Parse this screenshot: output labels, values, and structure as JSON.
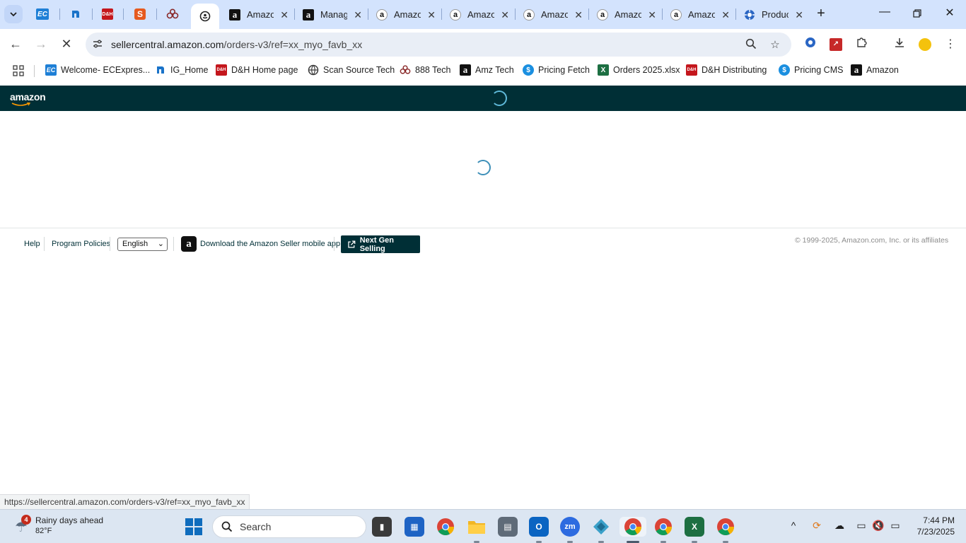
{
  "browser": {
    "tabs": [
      {
        "title": "Amazon",
        "favicon": "amazon-icon",
        "active": false
      },
      {
        "title": "Manage",
        "favicon": "amazon-icon",
        "active": false
      },
      {
        "title": "Amazon",
        "favicon": "amazon-smile-icon",
        "active": false
      },
      {
        "title": "Amazon",
        "favicon": "amazon-smile-icon",
        "active": false
      },
      {
        "title": "Amazon",
        "favicon": "amazon-smile-icon",
        "active": false
      },
      {
        "title": "Amazon",
        "favicon": "amazon-smile-icon",
        "active": false
      },
      {
        "title": "Amazon",
        "favicon": "amazon-smile-icon",
        "active": false
      },
      {
        "title": "Product",
        "favicon": "globe-icon",
        "active": false
      }
    ],
    "url_host": "sellercentral.amazon.com",
    "url_path": "/orders-v3/ref=xx_myo_favb_xx",
    "bookmarks": [
      {
        "label": "Welcome- ECExpres...",
        "favicon": "ec-icon"
      },
      {
        "label": "IG_Home",
        "favicon": "ig-icon"
      },
      {
        "label": "D&H Home page",
        "favicon": "dh-icon"
      },
      {
        "label": "Scan Source Tech",
        "favicon": "scansource-icon"
      },
      {
        "label": "888 Tech",
        "favicon": "888-icon"
      },
      {
        "label": "Amz Tech",
        "favicon": "amazon-icon"
      },
      {
        "label": "Pricing Fetch",
        "favicon": "dollar-icon"
      },
      {
        "label": "Orders 2025.xlsx",
        "favicon": "excel-icon"
      },
      {
        "label": "D&H Distributing",
        "favicon": "dh-icon"
      },
      {
        "label": "Pricing CMS",
        "favicon": "dollar-icon"
      },
      {
        "label": "Amazon",
        "favicon": "amazon-icon"
      }
    ],
    "status_url": "https://sellercentral.amazon.com/orders-v3/ref=xx_myo_favb_xx"
  },
  "page": {
    "logo": "amazon",
    "footer": {
      "help": "Help",
      "program_policies": "Program Policies",
      "language": "English",
      "app_text": "Download the Amazon Seller mobile app",
      "next_gen": "Next Gen Selling",
      "copyright": "© 1999-2025, Amazon.com, Inc. or its affiliates"
    }
  },
  "taskbar": {
    "weather_title": "Rainy days ahead",
    "weather_temp": "82°F",
    "weather_badge": "4",
    "search_placeholder": "Search",
    "time": "7:44 PM",
    "date": "7/23/2025"
  },
  "colors": {
    "amazon_header": "#002f36",
    "tabstrip": "#d3e3fd"
  }
}
